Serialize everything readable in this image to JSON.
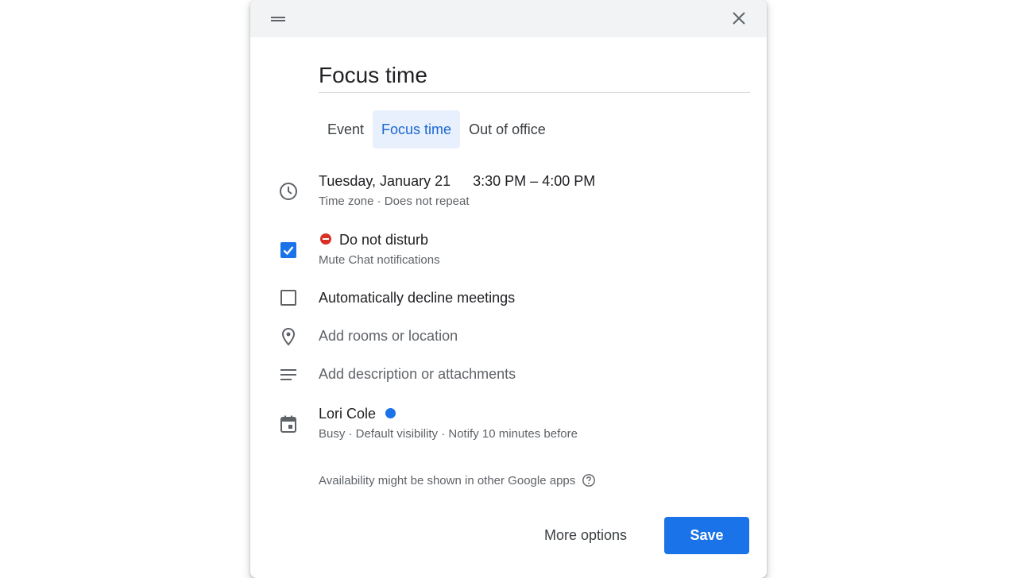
{
  "dialog": {
    "title_value": "Focus time",
    "tabs": [
      {
        "label": "Event",
        "active": false
      },
      {
        "label": "Focus time",
        "active": true
      },
      {
        "label": "Out of office",
        "active": false
      }
    ],
    "datetime": {
      "date": "Tuesday, January 21",
      "time_range": "3:30 PM – 4:00 PM",
      "details": "Time zone · Does not repeat"
    },
    "do_not_disturb": {
      "checked": true,
      "label": "Do not disturb",
      "sublabel": "Mute Chat notifications"
    },
    "auto_decline": {
      "checked": false,
      "label": "Automatically decline meetings"
    },
    "location_placeholder": "Add rooms or location",
    "description_placeholder": "Add description or attachments",
    "calendar": {
      "owner": "Lori Cole",
      "color": "#1a73e8",
      "details": "Busy · Default visibility · Notify 10 minutes before"
    },
    "availability_note": "Availability might be shown in other Google apps",
    "footer": {
      "more_options_label": "More options",
      "save_label": "Save"
    }
  },
  "colors": {
    "accent": "#1a73e8",
    "active_tab_bg": "#e8f0fe",
    "active_tab_text": "#1967d2",
    "dnd_red": "#d93025",
    "header_bg": "#f1f3f4"
  },
  "icons": {
    "header_left": "drag-handle-icon",
    "header_right": "close-icon",
    "datetime": "clock-icon",
    "location": "location-pin-icon",
    "description": "description-lines-icon",
    "calendar": "calendar-icon",
    "help": "help-circle-icon",
    "dnd": "do-not-disturb-icon"
  }
}
